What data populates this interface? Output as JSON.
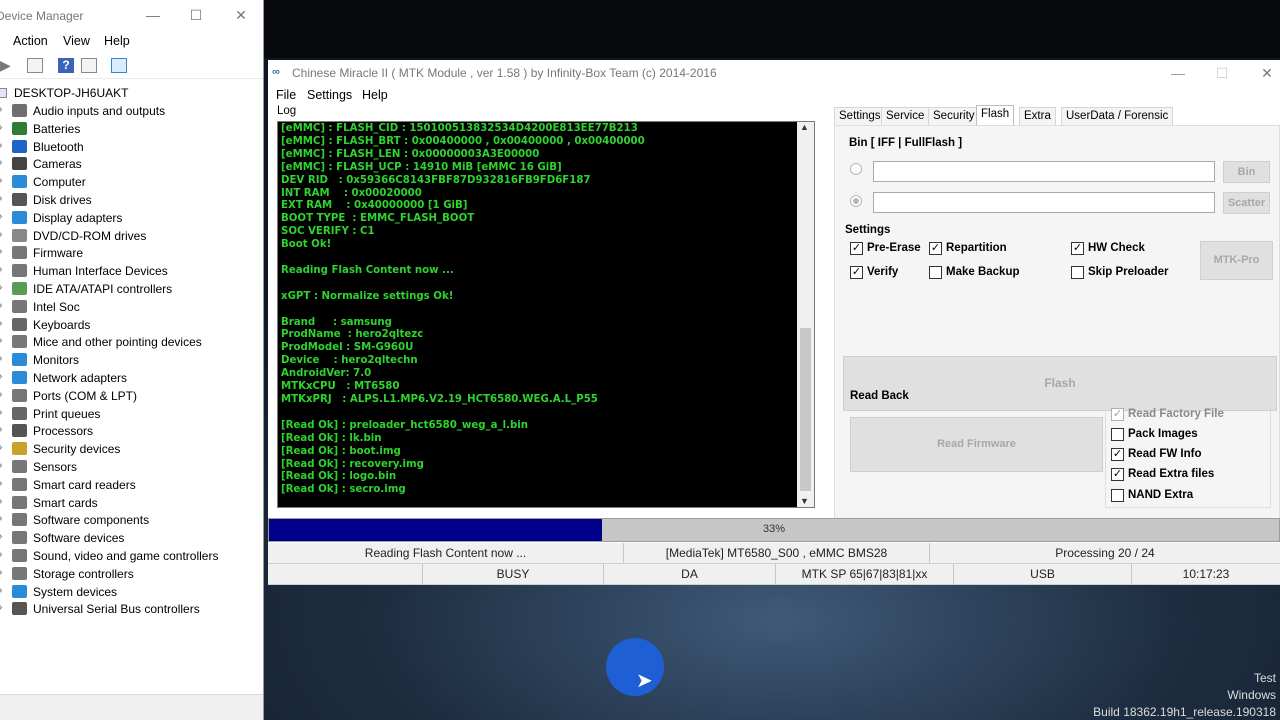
{
  "device_manager": {
    "title": "Device Manager",
    "menu": [
      "Action",
      "View",
      "Help"
    ],
    "root": "DESKTOP-JH6UAKT",
    "items": [
      {
        "label": "Audio inputs and outputs",
        "icon": "speaker-icon",
        "color": "#6f6f6f"
      },
      {
        "label": "Batteries",
        "icon": "battery-icon",
        "color": "#2f7d32"
      },
      {
        "label": "Bluetooth",
        "icon": "bluetooth-icon",
        "color": "#1e63c8"
      },
      {
        "label": "Cameras",
        "icon": "camera-icon",
        "color": "#444"
      },
      {
        "label": "Computer",
        "icon": "computer-icon",
        "color": "#2a8bd6"
      },
      {
        "label": "Disk drives",
        "icon": "disk-icon",
        "color": "#555"
      },
      {
        "label": "Display adapters",
        "icon": "display-adapter-icon",
        "color": "#2a8bd6"
      },
      {
        "label": "DVD/CD-ROM drives",
        "icon": "dvd-icon",
        "color": "#888"
      },
      {
        "label": "Firmware",
        "icon": "firmware-icon",
        "color": "#777"
      },
      {
        "label": "Human Interface Devices",
        "icon": "hid-icon",
        "color": "#777"
      },
      {
        "label": "IDE ATA/ATAPI controllers",
        "icon": "ide-icon",
        "color": "#5a9b56"
      },
      {
        "label": "Intel Soc",
        "icon": "chip-icon",
        "color": "#777"
      },
      {
        "label": "Keyboards",
        "icon": "keyboard-icon",
        "color": "#666"
      },
      {
        "label": "Mice and other pointing devices",
        "icon": "mouse-icon",
        "color": "#777"
      },
      {
        "label": "Monitors",
        "icon": "monitor-icon",
        "color": "#2a8bd6"
      },
      {
        "label": "Network adapters",
        "icon": "network-icon",
        "color": "#2a8bd6"
      },
      {
        "label": "Ports (COM & LPT)",
        "icon": "port-icon",
        "color": "#777"
      },
      {
        "label": "Print queues",
        "icon": "printer-icon",
        "color": "#666"
      },
      {
        "label": "Processors",
        "icon": "processor-icon",
        "color": "#555"
      },
      {
        "label": "Security devices",
        "icon": "security-icon",
        "color": "#c8a22a"
      },
      {
        "label": "Sensors",
        "icon": "sensor-icon",
        "color": "#777"
      },
      {
        "label": "Smart card readers",
        "icon": "card-reader-icon",
        "color": "#777"
      },
      {
        "label": "Smart cards",
        "icon": "smart-card-icon",
        "color": "#777"
      },
      {
        "label": "Software components",
        "icon": "component-icon",
        "color": "#777"
      },
      {
        "label": "Software devices",
        "icon": "software-device-icon",
        "color": "#777"
      },
      {
        "label": "Sound, video and game controllers",
        "icon": "sound-icon",
        "color": "#777"
      },
      {
        "label": "Storage controllers",
        "icon": "storage-icon",
        "color": "#777"
      },
      {
        "label": "System devices",
        "icon": "system-icon",
        "color": "#2a8bd6"
      },
      {
        "label": "Universal Serial Bus controllers",
        "icon": "usb-icon",
        "color": "#555"
      }
    ]
  },
  "miracle": {
    "title": "Chinese Miracle II ( MTK Module , ver 1.58 ) by Infinity-Box Team (c) 2014-2016",
    "menu": [
      "File",
      "Settings",
      "Help"
    ],
    "log_label": "Log",
    "log_lines": [
      "[eMMC] : FLASH_CID : 150100513832534D4200E813EE77B213",
      "[eMMC] : FLASH_BRT : 0x00400000 , 0x00400000 , 0x00400000",
      "[eMMC] : FLASH_LEN : 0x00000003A3E00000",
      "[eMMC] : FLASH_UCP : 14910 MiB [eMMC 16 GiB]",
      "DEV RID   : 0x59366C8143FBF87D932816FB9FD6F187",
      "INT RAM    : 0x00020000",
      "EXT RAM    : 0x40000000 [1 GiB]",
      "BOOT TYPE  : EMMC_FLASH_BOOT",
      "SOC VERIFY : C1",
      "Boot Ok!",
      "",
      "Reading Flash Content now ...",
      "",
      "xGPT : Normalize settings Ok!",
      "",
      "Brand     : samsung",
      "ProdName  : hero2qltezc",
      "ProdModel : SM-G960U",
      "Device    : hero2qltechn",
      "AndroidVer: 7.0",
      "MTKxCPU   : MT6580",
      "MTKxPRJ   : ALPS.L1.MP6.V2.19_HCT6580.WEG.A.L_P55",
      "",
      "[Read Ok] : preloader_hct6580_weg_a_l.bin",
      "[Read Ok] : lk.bin",
      "[Read Ok] : boot.img",
      "[Read Ok] : recovery.img",
      "[Read Ok] : logo.bin",
      "[Read Ok] : secro.img"
    ],
    "tabs": [
      "Settings",
      "Service",
      "Security",
      "Flash",
      "Extra",
      "UserData / Forensic"
    ],
    "active_tab": "Flash",
    "bin_group": "Bin  [ IFF | FullFlash ]",
    "bin_button": "Bin",
    "scatter_button": "Scatter",
    "settings_label": "Settings",
    "checks": {
      "pre_erase": {
        "label": "Pre-Erase",
        "checked": true
      },
      "repartition": {
        "label": "Repartition",
        "checked": true
      },
      "hw_check": {
        "label": "HW Check",
        "checked": true
      },
      "verify": {
        "label": "Verify",
        "checked": true
      },
      "make_backup": {
        "label": "Make Backup",
        "checked": false
      },
      "skip_preloader": {
        "label": "Skip Preloader",
        "checked": false
      }
    },
    "mtk_pro_button": "MTK-Pro",
    "flash_button": "Flash",
    "read_back_label": "Read Back",
    "read_firmware_button": "Read Firmware",
    "read_options": {
      "read_factory_file": {
        "label": "Read Factory File",
        "checked": true,
        "disabled": true
      },
      "pack_images": {
        "label": "Pack Images",
        "checked": false
      },
      "read_fw_info": {
        "label": "Read FW Info",
        "checked": true
      },
      "read_extra_files": {
        "label": "Read Extra files",
        "checked": true
      }
    },
    "nand_extra": {
      "label": "NAND Extra",
      "checked": false
    },
    "progress_percent": 33,
    "progress_text": "33%",
    "status1": [
      "Reading Flash Content now ...",
      "[MediaTek] MT6580_S00 , eMMC BMS28",
      "Processing 20 / 24"
    ],
    "status2": [
      "",
      "BUSY",
      "DA",
      "MTK SP 65|67|83|81|xx",
      "USB",
      "10:17:23"
    ],
    "progress_color": "#00008a",
    "log_color": "#2fd32f"
  },
  "watermark": [
    "Test",
    "Windows",
    "Build 18362.19h1_release.190318"
  ]
}
